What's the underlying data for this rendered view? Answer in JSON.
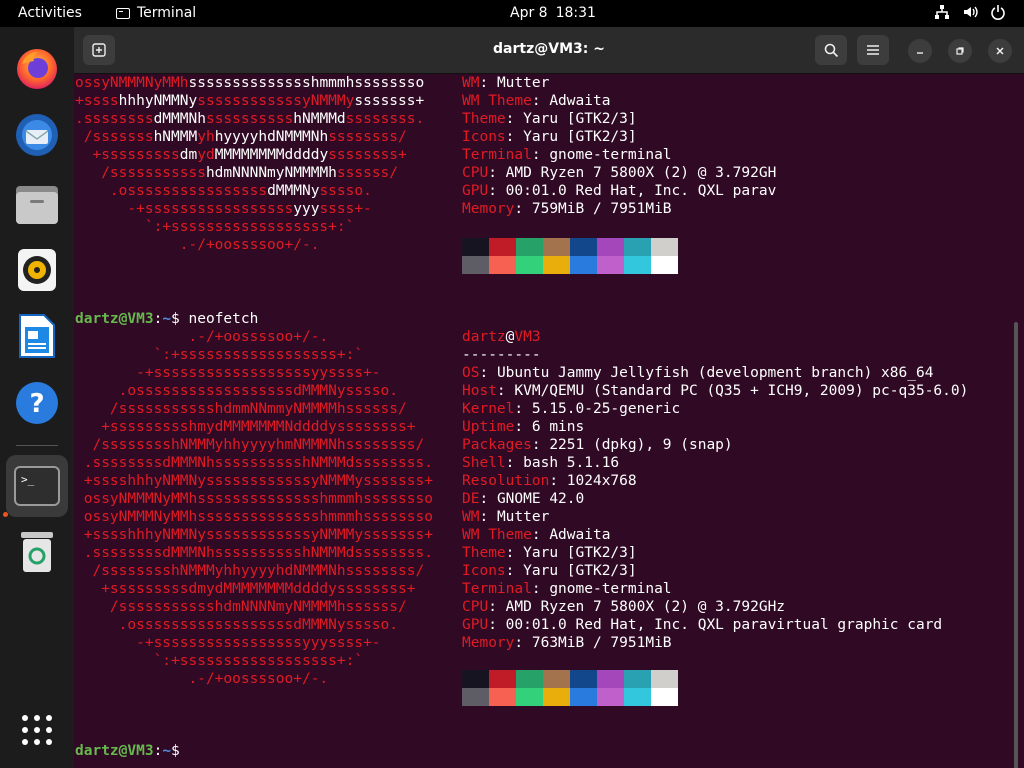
{
  "topbar": {
    "activities": "Activities",
    "app_name": "Terminal",
    "date": "Apr 8",
    "time": "18:31"
  },
  "window": {
    "title": "dartz@VM3: ~"
  },
  "dock": {
    "items": [
      "firefox-icon",
      "thunderbird-icon",
      "files-icon",
      "rhythmbox-icon",
      "libreoffice-writer-icon",
      "help-icon",
      "terminal-icon",
      "trash-icon",
      "show-apps-icon"
    ]
  },
  "colors": {
    "logo_red": "#e01b24",
    "prompt_user": "#66b94d",
    "prompt_path": "#4e8ee0",
    "terminal_bg": "#300a24",
    "palette_row1": [
      "#171421",
      "#c01c28",
      "#26a269",
      "#a2734c",
      "#12488b",
      "#a347ba",
      "#2aa1b3",
      "#d0cfcc"
    ],
    "palette_row2": [
      "#5e5c64",
      "#f66151",
      "#33d17a",
      "#e9ad0c",
      "#2a7bde",
      "#c061cb",
      "#33c7de",
      "#ffffff"
    ]
  },
  "prev_run": {
    "art": [
      [
        "ossyNMMMNyMMh",
        "sssssssssssssshmmmhssssssso"
      ],
      [
        "+ssss",
        "hhhyNMMNy",
        "ssssssssssssyNMMMy",
        "sssssss+"
      ],
      [
        ".ssssssss",
        "dMMMNh",
        "ssssssssss",
        "hNMMMd",
        "ssssssss."
      ],
      [
        " /sssssss",
        "hNMMM",
        "yh",
        "hyyyyhdNMMMNh",
        "ssssssss/"
      ],
      [
        "  +sssssssss",
        "dm",
        "yd",
        "MMMMMMMMddddy",
        "ssssssss+"
      ],
      [
        "   /sssssssssss",
        "hdmNNNNmyNMMMMh",
        "ssssss/"
      ],
      [
        "    .ossssssssssssssss",
        "dMMMNy",
        "sssso."
      ],
      [
        "      -+sssssssssssssssss",
        "yyy",
        "ssss+-"
      ],
      [
        "        `:+ssssssssssssssssss+:`"
      ],
      [
        "            .-/+oossssoo+/-."
      ]
    ],
    "info": [
      {
        "k": "WM",
        "v": "Mutter"
      },
      {
        "k": "WM Theme",
        "v": "Adwaita"
      },
      {
        "k": "Theme",
        "v": "Yaru [GTK2/3]"
      },
      {
        "k": "Icons",
        "v": "Yaru [GTK2/3]"
      },
      {
        "k": "Terminal",
        "v": "gnome-terminal"
      },
      {
        "k": "CPU",
        "v": "AMD Ryzen 7 5800X (2) @ 3.792GH"
      },
      {
        "k": "GPU",
        "v": "00:01.0 Red Hat, Inc. QXL parav"
      },
      {
        "k": "Memory",
        "v": "759MiB / 7951MiB"
      }
    ]
  },
  "prompt": {
    "user_host": "dartz@VM3",
    "sep": ":",
    "path": "~",
    "sym": "$",
    "command": " neofetch"
  },
  "current_run": {
    "header_user": "dartz",
    "header_at": "@",
    "header_host": "VM3",
    "underline": "---------",
    "art": [
      "             .-/+oossssoo+/-.",
      "         `:+ssssssssssssssssss+:`",
      "       -+ssssssssssssssssssyyssss+-",
      "     .ossssssssssssssssssdMMMNysssso.",
      "    /ssssssssssshdmmNNmmyNMMMMhssssss/",
      "   +ssssssssshmydMMMMMMMNddddyssssssss+",
      "  /sssssssshNMMMyhhyyyyhmNMMMNhssssssss/",
      " .ssssssssdMMMNhsssssssssshNMMMdssssssss.",
      " +sssshhhyNMMNyssssssssssssyNMMMysssssss+",
      " ossyNMMMNyMMhsssssssssssssshmmmhssssssso",
      " ossyNMMMNyMMhsssssssssssssshmmmhssssssso",
      " +sssshhhyNMMNyssssssssssssyNMMMysssssss+",
      " .ssssssssdMMMNhsssssssssshNMMMdssssssss.",
      "  /sssssssshNMMMyhhyyyyhdNMMMNhssssssss/",
      "   +sssssssssdmydMMMMMMMMddddyssssssss+",
      "    /ssssssssssshdmNNNNmyNMMMMhssssss/",
      "     .ossssssssssssssssssdMMMNysssso.",
      "       -+sssssssssssssssssyyyssss+-",
      "         `:+ssssssssssssssssss+:`",
      "             .-/+oossssoo+/-."
    ],
    "info": [
      {
        "k": "OS",
        "v": "Ubuntu Jammy Jellyfish (development branch) x86_64"
      },
      {
        "k": "Host",
        "v": "KVM/QEMU (Standard PC (Q35 + ICH9, 2009) pc-q35-6.0)"
      },
      {
        "k": "Kernel",
        "v": "5.15.0-25-generic"
      },
      {
        "k": "Uptime",
        "v": "6 mins"
      },
      {
        "k": "Packages",
        "v": "2251 (dpkg), 9 (snap)"
      },
      {
        "k": "Shell",
        "v": "bash 5.1.16"
      },
      {
        "k": "Resolution",
        "v": "1024x768"
      },
      {
        "k": "DE",
        "v": "GNOME 42.0"
      },
      {
        "k": "WM",
        "v": "Mutter"
      },
      {
        "k": "WM Theme",
        "v": "Adwaita"
      },
      {
        "k": "Theme",
        "v": "Yaru [GTK2/3]"
      },
      {
        "k": "Icons",
        "v": "Yaru [GTK2/3]"
      },
      {
        "k": "Terminal",
        "v": "gnome-terminal"
      },
      {
        "k": "CPU",
        "v": "AMD Ryzen 7 5800X (2) @ 3.792GHz"
      },
      {
        "k": "GPU",
        "v": "00:01.0 Red Hat, Inc. QXL paravirtual graphic card"
      },
      {
        "k": "Memory",
        "v": "763MiB / 7951MiB"
      }
    ]
  }
}
